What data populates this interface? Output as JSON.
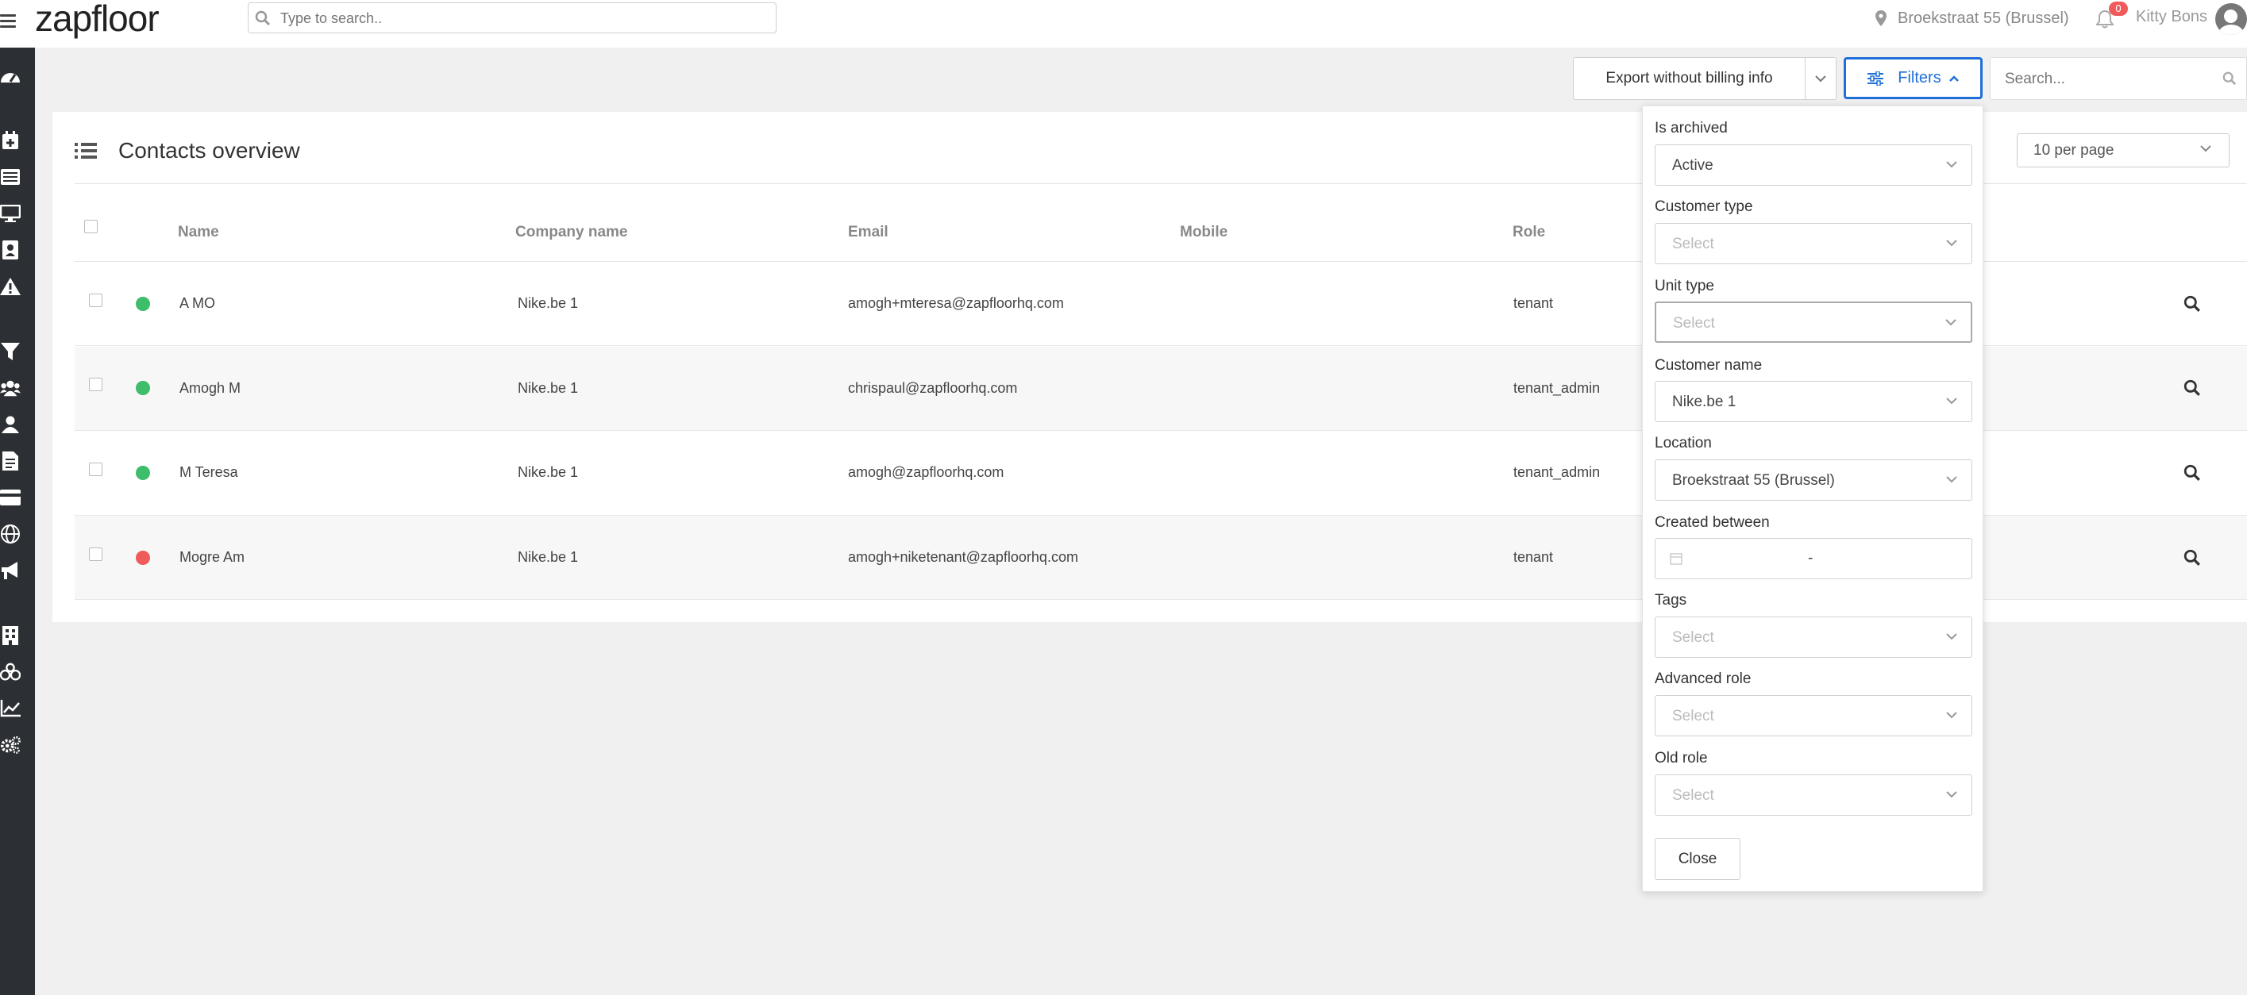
{
  "header": {
    "logo": "zapfloor",
    "search_placeholder": "Type to search..",
    "location": "Broekstraat 55 (Brussel)",
    "notification_count": "0",
    "user_name": "Kitty Bons"
  },
  "toolbar": {
    "export_label": "Export without billing info",
    "filters_label": "Filters",
    "search_placeholder": "Search..."
  },
  "card": {
    "title": "Contacts overview",
    "per_page": "10 per page"
  },
  "table": {
    "columns": [
      "Name",
      "Company name",
      "Email",
      "Mobile",
      "Role"
    ],
    "rows": [
      {
        "name": "A MO",
        "company": "Nike.be 1",
        "email": "amogh+mteresa@zapfloorhq.com",
        "mobile": "",
        "role": "tenant",
        "status_color": "#3ebd6b"
      },
      {
        "name": "Amogh M",
        "company": "Nike.be 1",
        "email": "chrispaul@zapfloorhq.com",
        "mobile": "",
        "role": "tenant_admin",
        "status_color": "#3ebd6b"
      },
      {
        "name": "M Teresa",
        "company": "Nike.be 1",
        "email": "amogh@zapfloorhq.com",
        "mobile": "",
        "role": "tenant_admin",
        "status_color": "#3ebd6b"
      },
      {
        "name": "Mogre Am",
        "company": "Nike.be 1",
        "email": "amogh+niketenant@zapfloorhq.com",
        "mobile": "",
        "role": "tenant",
        "status_color": "#ef5b5b"
      }
    ]
  },
  "filters": {
    "is_archived": {
      "label": "Is archived",
      "value": "Active"
    },
    "customer_type": {
      "label": "Customer type",
      "placeholder": "Select"
    },
    "unit_type": {
      "label": "Unit type",
      "placeholder": "Select"
    },
    "customer_name": {
      "label": "Customer name",
      "value": "Nike.be 1"
    },
    "location": {
      "label": "Location",
      "value": "Broekstraat 55 (Brussel)"
    },
    "created_between": {
      "label": "Created between",
      "separator": "-"
    },
    "tags": {
      "label": "Tags",
      "placeholder": "Select"
    },
    "advanced_role": {
      "label": "Advanced role",
      "placeholder": "Select"
    },
    "old_role": {
      "label": "Old role",
      "placeholder": "Select"
    },
    "close_label": "Close"
  },
  "colors": {
    "accent": "#1e6fd9",
    "sidebar": "#2c2f33",
    "active_status": "#3ebd6b",
    "inactive_status": "#ef5b5b"
  },
  "sidebar_icons": [
    "dashboard-icon",
    "calendar-plus-icon",
    "list-icon",
    "desktop-icon",
    "contact-card-icon",
    "warning-icon",
    "filter-icon",
    "users-icon",
    "user-icon",
    "invoice-icon",
    "credit-card-icon",
    "globe-icon",
    "megaphone-icon",
    "building-icon",
    "bicycles-icon",
    "chart-line-icon",
    "cogs-icon"
  ]
}
